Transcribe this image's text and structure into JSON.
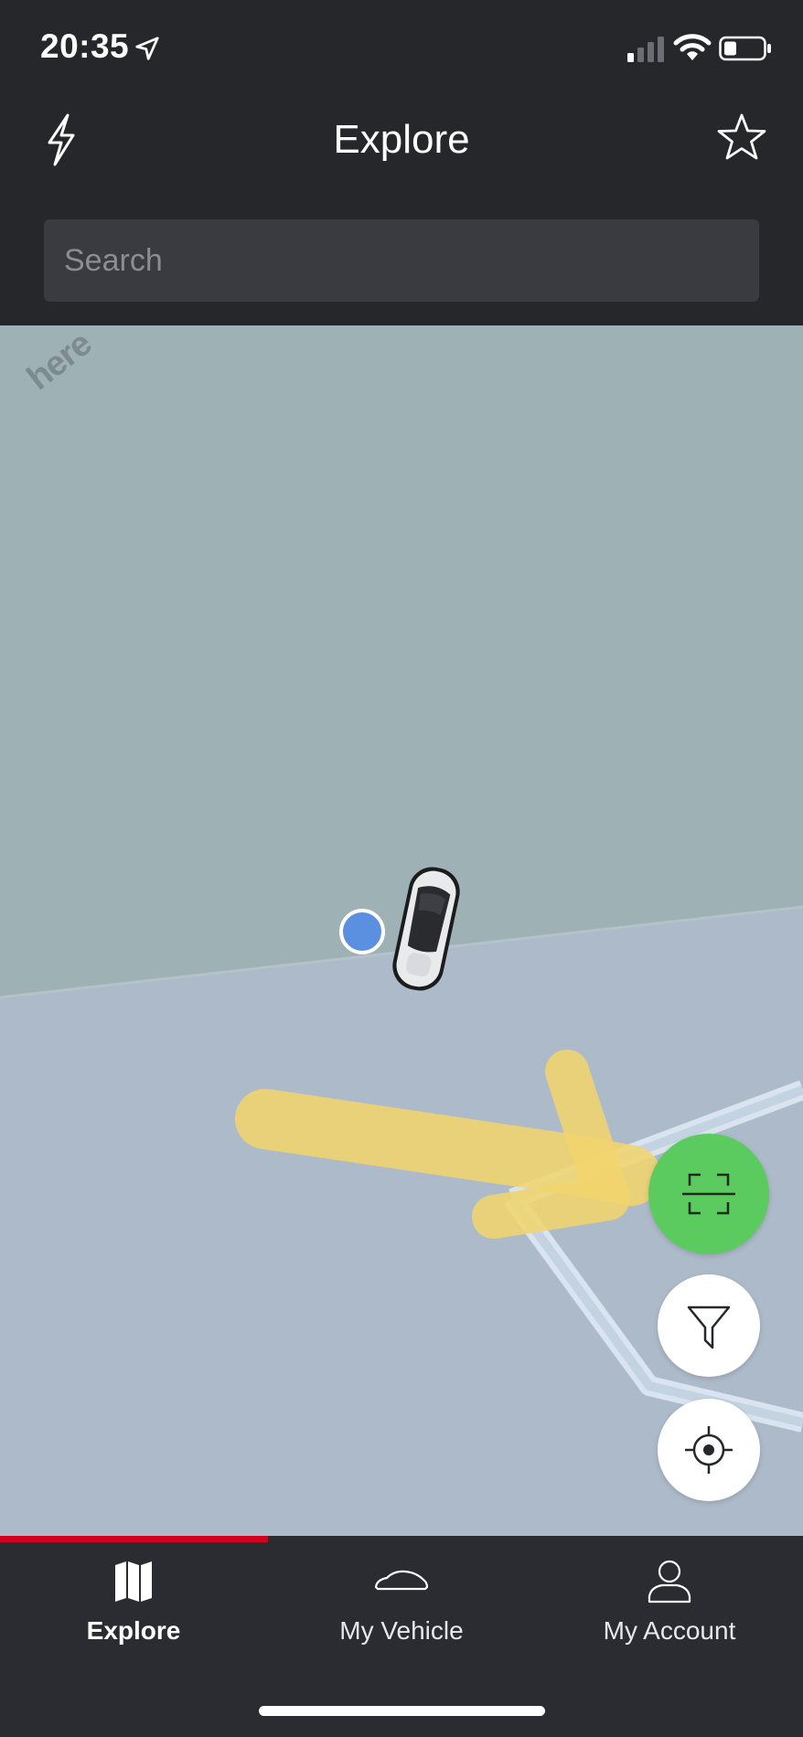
{
  "status_bar": {
    "time": "20:35",
    "icons": [
      "location-arrow-icon",
      "cellular-signal-icon",
      "wifi-icon",
      "battery-icon"
    ]
  },
  "header": {
    "title": "Explore",
    "left_icon": "lightning-bolt-icon",
    "right_icon": "star-icon"
  },
  "search": {
    "placeholder": "Search",
    "value": ""
  },
  "map": {
    "provider_logo": "here",
    "markers": [
      "user-location-dot",
      "vehicle-marker"
    ],
    "controls": [
      {
        "name": "scan-button",
        "icon": "scan-frame-icon",
        "color": "#5ccb5f"
      },
      {
        "name": "filter-button",
        "icon": "filter-funnel-icon",
        "color": "#ffffff"
      },
      {
        "name": "locate-button",
        "icon": "crosshair-icon",
        "color": "#ffffff"
      }
    ]
  },
  "tab_bar": {
    "accent_color": "#d5001c",
    "tabs": [
      {
        "label": "Explore",
        "icon": "map-icon",
        "active": true
      },
      {
        "label": "My Vehicle",
        "icon": "car-icon",
        "active": false
      },
      {
        "label": "My Account",
        "icon": "person-icon",
        "active": false
      }
    ]
  }
}
